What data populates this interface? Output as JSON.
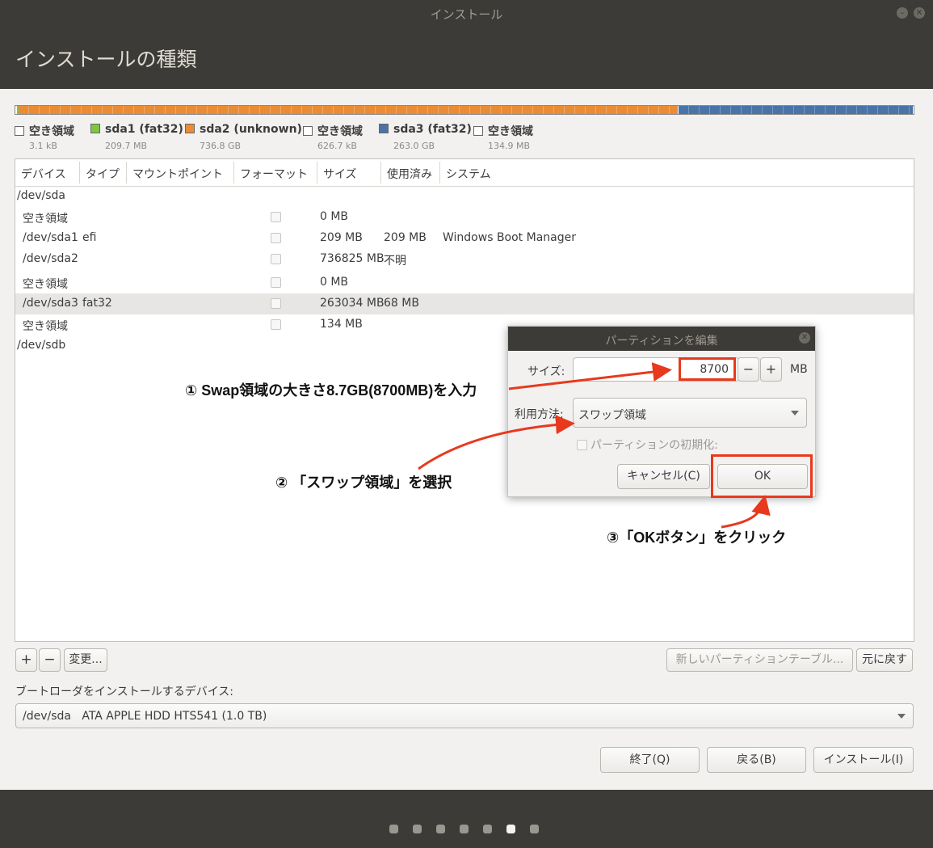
{
  "window": {
    "title": "インストール"
  },
  "header": {
    "title": "インストールの種類"
  },
  "partition_bar": [
    {
      "label": "空き領域",
      "size": "3.1 kB",
      "color": "#ffffff",
      "fraction": 0.0001
    },
    {
      "label": "sda1 (fat32)",
      "size": "209.7 MB",
      "color": "#7dc742",
      "fraction": 0.0002
    },
    {
      "label": "sda2 (unknown)",
      "size": "736.8 GB",
      "color": "#ea8c36",
      "fraction": 0.736
    },
    {
      "label": "空き領域",
      "size": "626.7 kB",
      "color": "#ffffff",
      "fraction": 0.0001
    },
    {
      "label": "sda3 (fat32)",
      "size": "263.0 GB",
      "color": "#4a74a8",
      "fraction": 0.263
    },
    {
      "label": "空き領域",
      "size": "134.9 MB",
      "color": "#ffffff",
      "fraction": 0.0006
    }
  ],
  "table": {
    "columns": [
      "デバイス",
      "タイプ",
      "マウントポイント",
      "フォーマット",
      "サイズ",
      "使用済み",
      "システム"
    ],
    "rows": [
      {
        "device": "/dev/sda",
        "type": "",
        "mount": "",
        "size": "",
        "used": "",
        "system": ""
      },
      {
        "device": "空き領域",
        "type": "",
        "mount": "",
        "size": "0 MB",
        "used": "",
        "system": ""
      },
      {
        "device": "/dev/sda1",
        "type": "efi",
        "mount": "",
        "size": "209 MB",
        "used": "209 MB",
        "system": "Windows Boot Manager"
      },
      {
        "device": "/dev/sda2",
        "type": "",
        "mount": "",
        "size": "736825 MB",
        "used": "不明",
        "system": ""
      },
      {
        "device": "空き領域",
        "type": "",
        "mount": "",
        "size": "0 MB",
        "used": "",
        "system": ""
      },
      {
        "device": "/dev/sda3",
        "type": "fat32",
        "mount": "",
        "size": "263034 MB",
        "used": "68 MB",
        "system": ""
      },
      {
        "device": "空き領域",
        "type": "",
        "mount": "",
        "size": "134 MB",
        "used": "",
        "system": ""
      },
      {
        "device": "/dev/sdb",
        "type": "",
        "mount": "",
        "size": "",
        "used": "",
        "system": ""
      }
    ]
  },
  "toolbar": {
    "add": "+",
    "remove": "−",
    "change": "変更...",
    "new_table": "新しいパーティションテーブル...",
    "revert": "元に戻す"
  },
  "bootloader": {
    "label": "ブートローダをインストールするデバイス:",
    "value": "/dev/sda   ATA APPLE HDD HTS541 (1.0 TB)"
  },
  "nav": {
    "quit": "終了(Q)",
    "back": "戻る(B)",
    "install": "インストール(I)"
  },
  "dialog": {
    "title": "パーティションを編集",
    "size_label": "サイズ:",
    "size_value": "8700",
    "minus": "−",
    "plus": "+",
    "unit": "MB",
    "use_label": "利用方法:",
    "use_value": "スワップ領域",
    "format_label": "パーティションの初期化:",
    "cancel": "キャンセル(C)",
    "ok": "OK"
  },
  "annotations": {
    "step1": "① Swap領域の大きさ8.7GB(8700MB)を入力",
    "step2": "② 「スワップ領域」を選択",
    "step3": "③「OKボタン」をクリック"
  },
  "progress": {
    "steps": 7,
    "current": 6
  },
  "colors": {
    "highlight": "#e8391d",
    "chrome": "#3c3b37"
  }
}
